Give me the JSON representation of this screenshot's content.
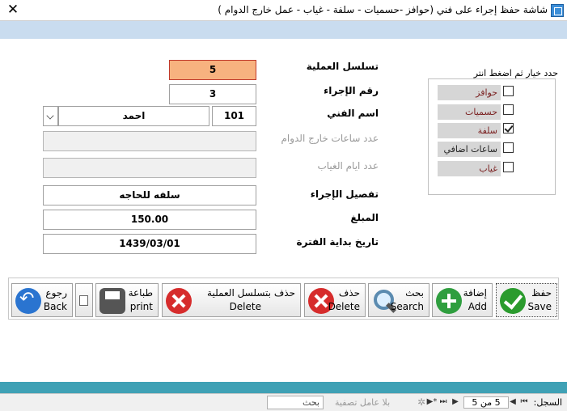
{
  "window": {
    "title": "شاشة حفظ إجراء على فني (حوافز -حسميات - سلفة - غياب - عمل خارج الدوام )",
    "close_glyph": "✕"
  },
  "form": {
    "fields": {
      "op_serial": {
        "label": "تسلسل العملية",
        "value": "5"
      },
      "proc_number": {
        "label": "رقم الإجراء",
        "value": "3"
      },
      "tech_name": {
        "label": "اسم الفني",
        "code": "101",
        "name": "احمد"
      },
      "overtime_hours": {
        "label": "عدد ساعات خارج الدوام",
        "value": ""
      },
      "absence_days": {
        "label": "عدد ايام الغياب",
        "value": ""
      },
      "proc_detail": {
        "label": "تفصيل الإجراء",
        "value": "سلفه للحاجه"
      },
      "amount": {
        "label": "المبلغ",
        "value": "150.00"
      },
      "period_start": {
        "label": "تاريخ بداية الفترة",
        "value": "1439/03/01"
      }
    },
    "options_group": {
      "title": "حدد خيار ثم اضغط انتر",
      "options": [
        {
          "label": "حوافز",
          "checked": false
        },
        {
          "label": "حسميات",
          "checked": false
        },
        {
          "label": "سلفة",
          "checked": true
        },
        {
          "label": "ساعات اضافي",
          "checked": false
        },
        {
          "label": "غياب",
          "checked": false
        }
      ]
    }
  },
  "toolbar": {
    "save": {
      "ar": "حفظ",
      "en": "Save"
    },
    "add": {
      "ar": "إضافة",
      "en": "Add"
    },
    "search": {
      "ar": "بحث",
      "en": "Search"
    },
    "delete": {
      "ar": "حذف",
      "en": "Delete"
    },
    "delete_by_serial": {
      "ar": "حذف بتسلسل العملية",
      "en": "Delete"
    },
    "print": {
      "ar": "طباعة",
      "en": "print"
    },
    "back": {
      "ar": "رجوع",
      "en": "Back"
    }
  },
  "statusbar": {
    "record_label": "السجل:",
    "record_position": "5 من 5",
    "filter_text": "بلا عامل تصفية",
    "search_text": "بحث",
    "nav": {
      "first": "⏮",
      "prev": "◀",
      "next": "▶",
      "last": "⏭",
      "new": "▶*"
    }
  },
  "colors": {
    "ribbon": "#c9dcef",
    "serial_field": "#f7b27f",
    "bottom_band": "#3fa1b5"
  }
}
